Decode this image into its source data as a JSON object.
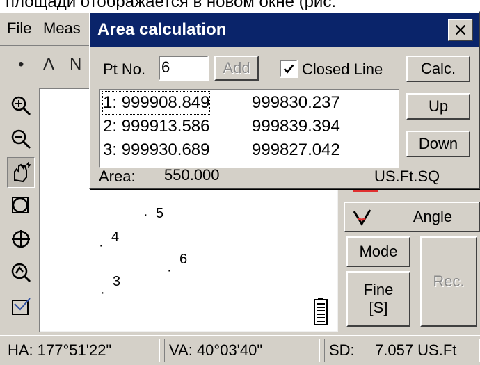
{
  "caption": "площади отображается в новом окне (рис.",
  "menu": [
    "File",
    "Meas"
  ],
  "toolbar": {
    "dot": "•",
    "polyline": "Ʌ",
    "curve": "Ν"
  },
  "dialog": {
    "title": "Area calculation",
    "pt_label": "Pt No.",
    "pt_value": "6",
    "add_label": "Add",
    "closed_line_label": "Closed Line",
    "closed_line_checked": true,
    "calc_label": "Calc.",
    "up_label": "Up",
    "down_label": "Down",
    "points": [
      {
        "id": "1:",
        "x": "999908.849",
        "y": "999830.237"
      },
      {
        "id": "2:",
        "x": "999913.586",
        "y": "999839.394"
      },
      {
        "id": "3:",
        "x": "999930.689",
        "y": "999827.042"
      }
    ],
    "area_label": "Area:",
    "area_value": "550.000",
    "area_unit": "US.Ft.SQ"
  },
  "canvas_points": [
    "5",
    "4",
    "6",
    "3"
  ],
  "right": {
    "angle_label": "Angle",
    "mode_label": "Mode",
    "fine_label": "Fine",
    "fine_sub": "[S]",
    "rec_label": "Rec."
  },
  "status": {
    "ha": "HA: 177°51'22\"",
    "va": "VA:  40°03'40\"",
    "sd_label": "SD:",
    "sd_value": "7.057 US.Ft"
  }
}
